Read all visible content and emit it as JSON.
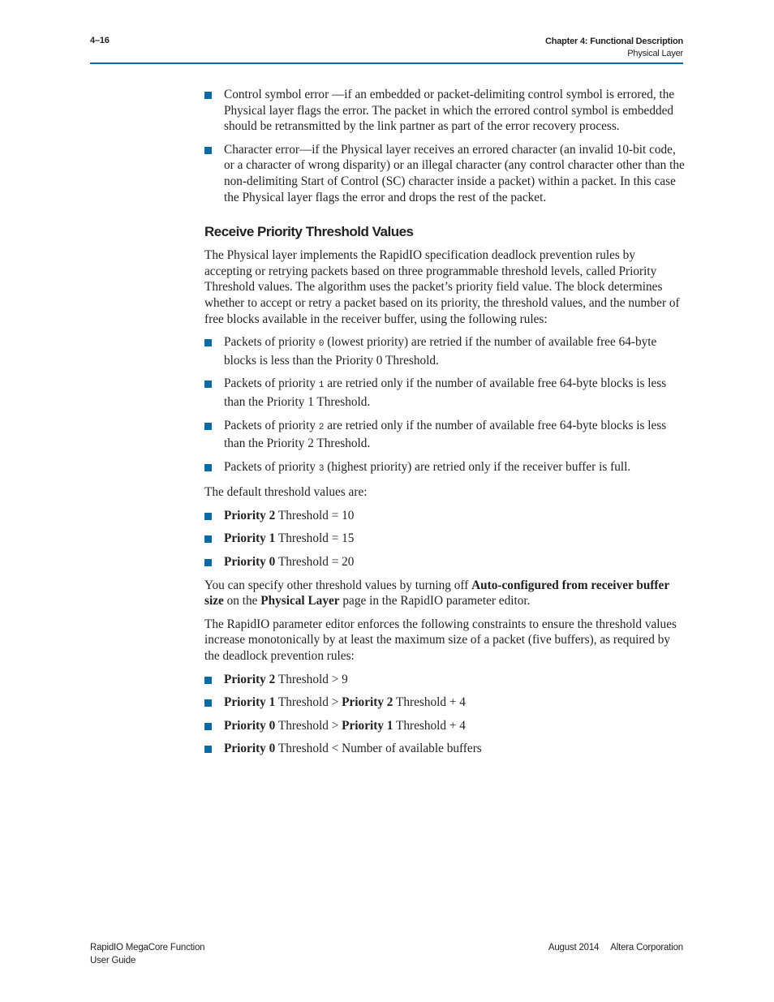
{
  "header": {
    "page_number": "4–16",
    "chapter": "Chapter 4:  Functional Description",
    "section": "Physical Layer",
    "accent_color": "#0a6aa1"
  },
  "error_bullets": [
    "Control symbol error —if an embedded or packet-delimiting control symbol is errored, the Physical layer flags the error. The packet in which the errored control symbol is embedded should be retransmitted by the link partner as part of the error recovery process.",
    "Character error—if the Physical layer receives an errored character (an invalid 10-bit code, or a character of wrong disparity) or an illegal character (any control character other than the non-delimiting Start of Control (SC) character inside a packet) within a packet. In this case the Physical layer flags the error and drops the rest of the packet."
  ],
  "section": {
    "heading": "Receive Priority Threshold Values",
    "intro": "The Physical layer implements the RapidIO specification deadlock prevention rules by accepting or retrying packets based on three programmable threshold levels, called Priority Threshold values. The algorithm uses the packet’s priority field value. The block determines whether to accept or retry a packet based on its priority, the threshold values, and the number of free blocks available in the receiver buffer, using the following rules:",
    "rules": [
      {
        "pre": "Packets of priority ",
        "code": "0",
        "post": " (lowest priority) are retried if the number of available free 64-byte blocks is less than the Priority 0 Threshold."
      },
      {
        "pre": "Packets of priority ",
        "code": "1",
        "post": " are retried only if the number of available free 64-byte blocks is less than the Priority 1 Threshold."
      },
      {
        "pre": "Packets of priority ",
        "code": "2",
        "post": " are retried only if the number of available free 64-byte blocks is less than the Priority 2 Threshold."
      },
      {
        "pre": "Packets of priority ",
        "code": "3",
        "post": " (highest priority) are retried only if the receiver buffer is full."
      }
    ],
    "defaults_intro": "The default threshold values are:",
    "defaults": [
      {
        "bold": "Priority 2",
        "rest": " Threshold = 10"
      },
      {
        "bold": "Priority 1",
        "rest": " Threshold = 15"
      },
      {
        "bold": "Priority 0",
        "rest": " Threshold = 20"
      }
    ],
    "specify": {
      "t1": "You can specify other threshold values by turning off ",
      "b1": "Auto-configured from receiver buffer size",
      "t2": " on the ",
      "b2": "Physical Layer",
      "t3": " page in the RapidIO parameter editor."
    },
    "constraints_intro": "The RapidIO parameter editor enforces the following constraints to ensure the threshold values increase monotonically by at least the maximum size of a packet (five buffers), as required by the deadlock prevention rules:",
    "constraints": [
      {
        "b1": "Priority 2",
        "t1": " Threshold > 9",
        "b2": "",
        "t2": ""
      },
      {
        "b1": "Priority 1",
        "t1": " Threshold > ",
        "b2": "Priority 2",
        "t2": " Threshold + 4"
      },
      {
        "b1": "Priority 0",
        "t1": " Threshold > ",
        "b2": "Priority 1",
        "t2": " Threshold + 4"
      },
      {
        "b1": "Priority 0",
        "t1": " Threshold < Number of available buffers",
        "b2": "",
        "t2": ""
      }
    ]
  },
  "footer": {
    "title_line1": "RapidIO MegaCore Function",
    "title_line2": "User Guide",
    "date": "August 2014",
    "company": "Altera Corporation"
  }
}
